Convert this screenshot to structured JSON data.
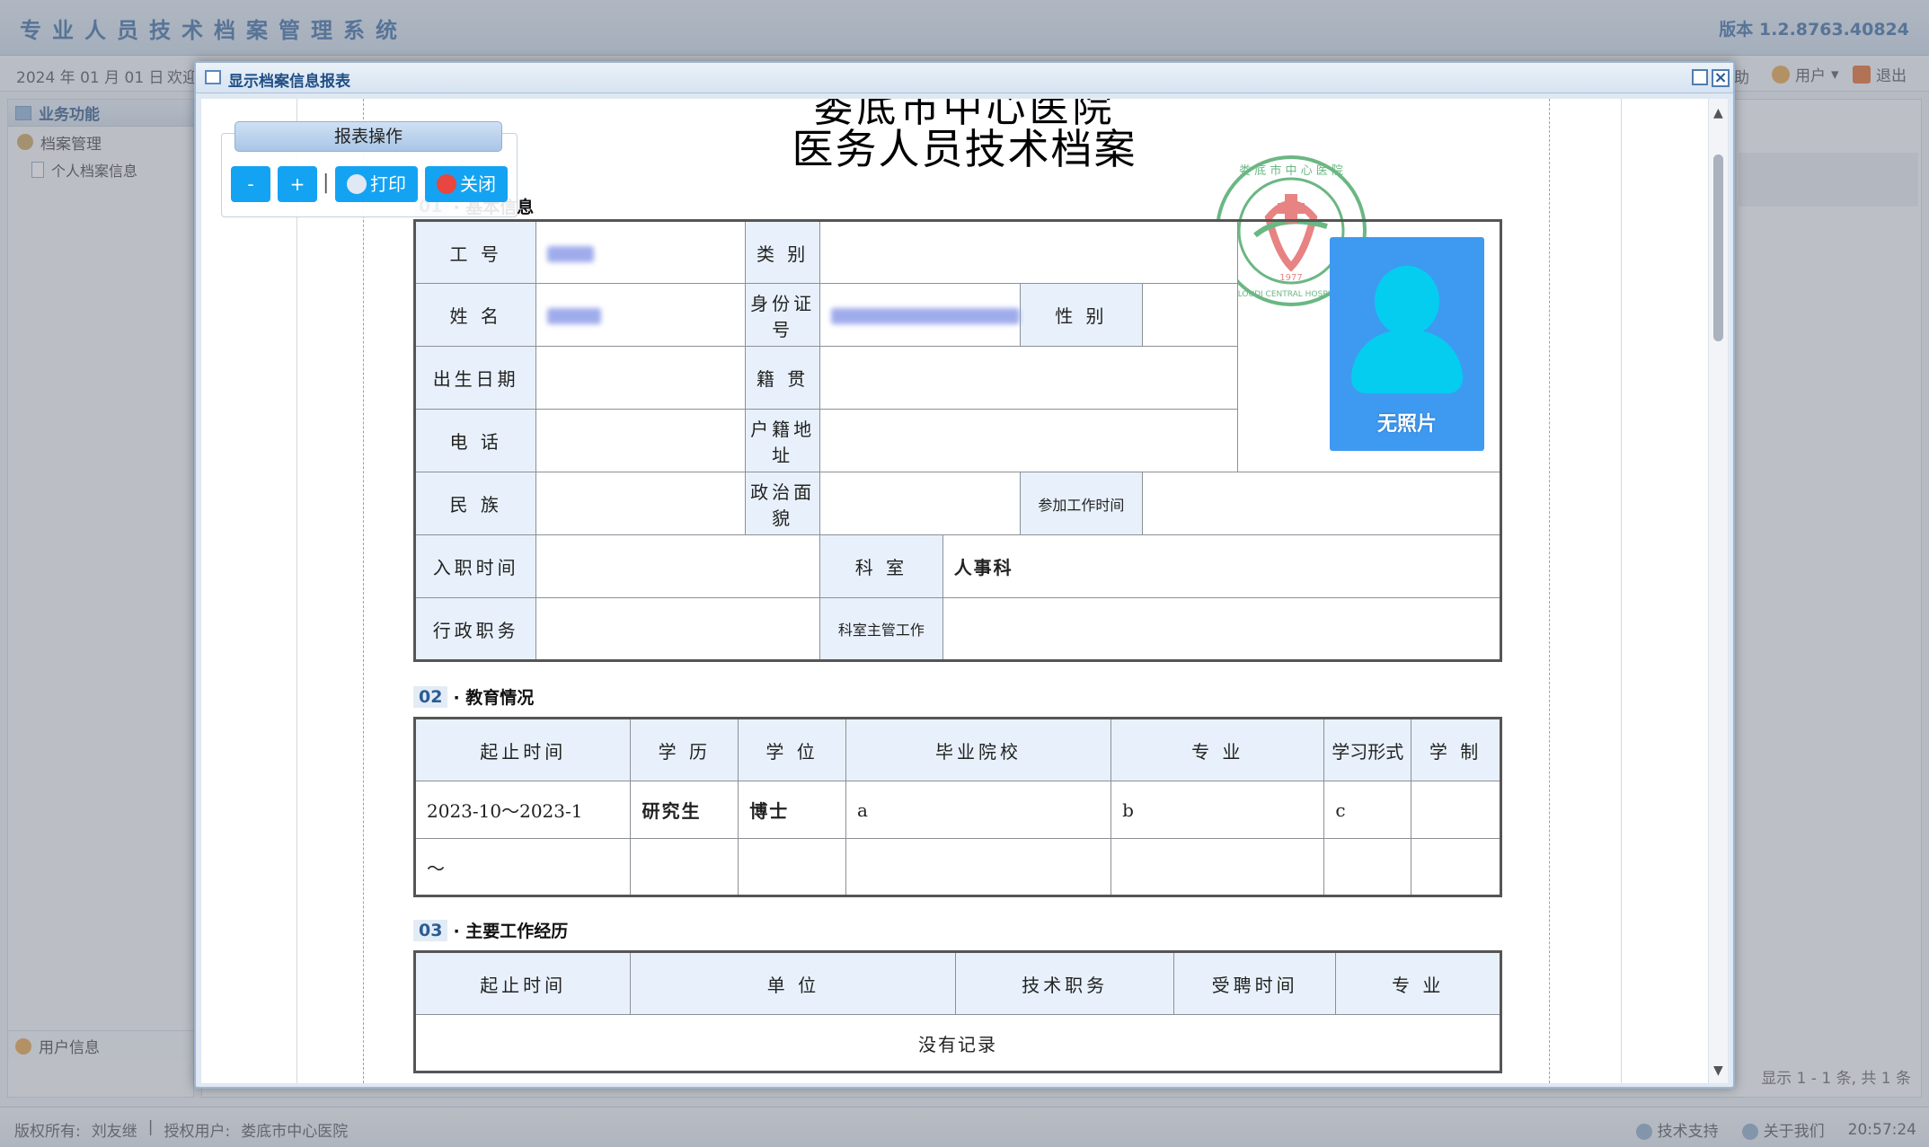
{
  "app": {
    "title": "专业人员技术档案管理系统",
    "version": "版本 1.2.8763.40824",
    "toolbar": {
      "date": "2024 年 01 月 01 日",
      "welcome": "欢迎",
      "help": "助",
      "user": "用户",
      "logout": "退出"
    },
    "sidebar": {
      "heading": "业务功能",
      "group": "档案管理",
      "item": "个人档案信息",
      "user_info": "用户信息"
    },
    "pager": "显示 1 - 1 条, 共 1 条",
    "footer": {
      "copyright_label": "版权所有:",
      "copyright_name": "刘友继",
      "licensed_label": "授权用户:",
      "licensed_name": "娄底市中心医院",
      "support": "技术支持",
      "about": "关于我们",
      "time": "20:57:24"
    }
  },
  "dialog": {
    "title": "显示档案信息报表",
    "ops": {
      "title": "报表操作",
      "zoom_out": "-",
      "zoom_in": "+",
      "separator": "|",
      "print": "打印",
      "close": "关闭"
    }
  },
  "report": {
    "top_cut": "娄底市中心医院",
    "title": "医务人员技术档案",
    "photo_label": "无照片",
    "seal": {
      "top": "娄 底 市 中 心 医 院",
      "bottom": "LOUDI CENTRAL HOSPITAL",
      "year": "1977"
    },
    "sections": {
      "basic": {
        "num": "01",
        "label": "· 基本信息"
      },
      "education": {
        "num": "02",
        "label": "· 教育情况"
      },
      "work": {
        "num": "03",
        "label": "· 主要工作经历"
      }
    },
    "basic_labels": {
      "job_no": "工 号",
      "category": "类 别",
      "name": "姓 名",
      "id_no": "身份证号",
      "gender": "性 别",
      "birth": "出生日期",
      "native": "籍 贯",
      "phone": "电 话",
      "household": "户籍地址",
      "ethnic": "民 族",
      "political": "政治面貌",
      "work_start": "参加工作时间",
      "hire_date": "入职时间",
      "dept": "科 室",
      "admin_post": "行政职务",
      "dept_duty": "科室主管工作"
    },
    "basic_values": {
      "dept": "人事科"
    },
    "education": {
      "headers": [
        "起止时间",
        "学 历",
        "学 位",
        "毕业院校",
        "专 业",
        "学习形式",
        "学 制"
      ],
      "rows": [
        [
          "2023-10～2023-1",
          "研究生",
          "博士",
          "a",
          "b",
          "c",
          ""
        ],
        [
          "～",
          "",
          "",
          "",
          "",
          "",
          ""
        ]
      ]
    },
    "work": {
      "headers": [
        "起止时间",
        "单 位",
        "技术职务",
        "受聘时间",
        "专 业"
      ],
      "empty": "没有记录"
    }
  },
  "colors": {
    "label_bg": "#e8f1fb",
    "dept_text": "#1a4dd6",
    "edu_text": "#7b1fb0",
    "button": "#14a3f2"
  }
}
